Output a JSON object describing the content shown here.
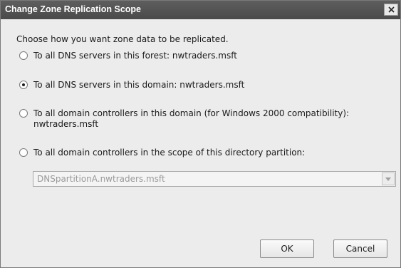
{
  "dialog": {
    "title": "Change Zone Replication Scope",
    "prompt": "Choose how you want zone data to be replicated."
  },
  "options": [
    {
      "label": "To all DNS servers in this forest: nwtraders.msft",
      "selected": false
    },
    {
      "label": "To all DNS servers in this domain: nwtraders.msft",
      "selected": true
    },
    {
      "label_line1": "To all domain controllers in this domain (for Windows 2000 compatibility):",
      "label_line2": "nwtraders.msft",
      "selected": false
    },
    {
      "label": "To all domain controllers in the scope of this directory partition:",
      "selected": false
    }
  ],
  "partition_select": {
    "value": "DNSpartitionA.nwtraders.msft",
    "enabled": false
  },
  "buttons": {
    "ok": "OK",
    "cancel": "Cancel"
  },
  "icons": {
    "close": "close-icon",
    "dropdown": "chevron-down-icon"
  }
}
